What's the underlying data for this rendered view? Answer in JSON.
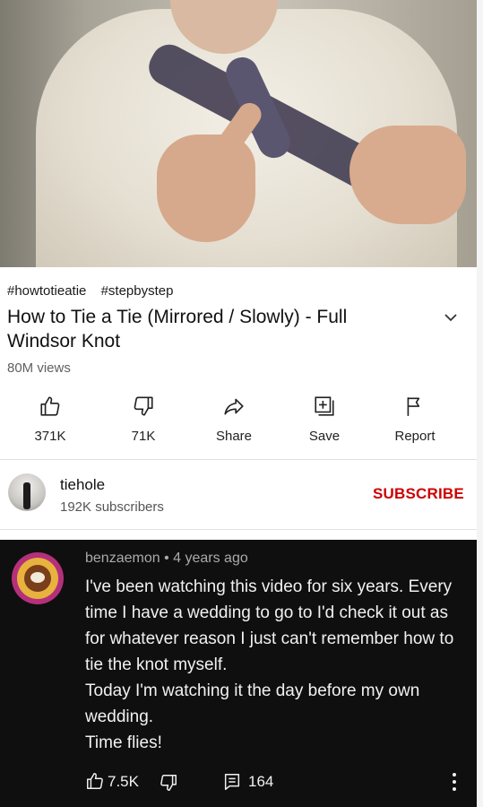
{
  "video": {
    "hashtags": [
      "#howtotieatie",
      "#stepbystep"
    ],
    "title": "How to Tie a Tie (Mirrored / Slowly) - Full Windsor Knot",
    "views": "80M views"
  },
  "actions": {
    "like": "371K",
    "dislike": "71K",
    "share": "Share",
    "save": "Save",
    "report": "Report"
  },
  "channel": {
    "name": "tiehole",
    "subscribers": "192K subscribers",
    "subscribe_label": "SUBSCRIBE"
  },
  "comment": {
    "author": "benzaemon",
    "separator": "•",
    "time": "4 years ago",
    "lines": [
      "I've been watching this video for six years. Every time I have a wedding to go to I'd check it out as for whatever reason I just can't remember how to tie the knot myself.",
      "Today I'm watching it the day before my own wedding.",
      "Time flies!"
    ],
    "likes": "7.5K",
    "replies": "164"
  },
  "colors": {
    "subscribe": "#cc0000",
    "comment_bg": "#0f0f0f"
  }
}
